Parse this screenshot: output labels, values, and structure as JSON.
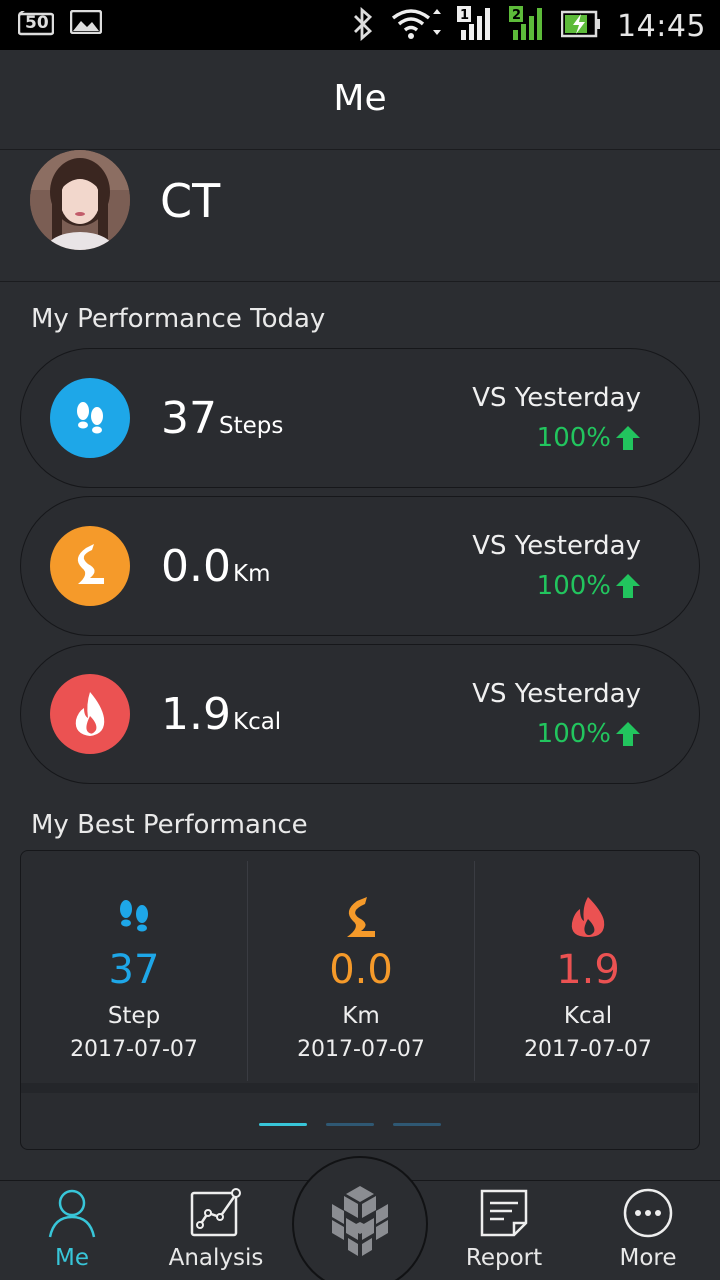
{
  "status_bar": {
    "time": "14:45",
    "notification_badge": "50",
    "icons": [
      "notification-50-icon",
      "image-icon",
      "bluetooth-icon",
      "wifi-icon",
      "signal-sim1-icon",
      "signal-sim2-icon",
      "battery-charging-icon"
    ]
  },
  "header": {
    "title": "Me"
  },
  "profile": {
    "name": "CT"
  },
  "today": {
    "section_title": "My Performance Today",
    "items": [
      {
        "value": "37",
        "unit": "Steps",
        "vs_label": "VS Yesterday",
        "change": "100%",
        "icon": "footprints-icon",
        "color": "#1ea7e8"
      },
      {
        "value": "0.0",
        "unit": "Km",
        "vs_label": "VS Yesterday",
        "change": "100%",
        "icon": "road-icon",
        "color": "#f59a2a"
      },
      {
        "value": "1.9",
        "unit": "Kcal",
        "vs_label": "VS Yesterday",
        "change": "100%",
        "icon": "flame-icon",
        "color": "#eb5252"
      }
    ]
  },
  "best": {
    "section_title": "My Best Performance",
    "items": [
      {
        "value": "37",
        "unit": "Step",
        "date": "2017-07-07",
        "icon": "footprints-icon",
        "color": "#1ea7e8"
      },
      {
        "value": "0.0",
        "unit": "Km",
        "date": "2017-07-07",
        "icon": "road-icon",
        "color": "#f59a2a"
      },
      {
        "value": "1.9",
        "unit": "Kcal",
        "date": "2017-07-07",
        "icon": "flame-icon",
        "color": "#eb5252"
      }
    ],
    "page_indicator": {
      "count": 3,
      "active": 1
    }
  },
  "bottom_nav": {
    "items": [
      {
        "label": "Me",
        "icon": "person-icon",
        "active": true
      },
      {
        "label": "Analysis",
        "icon": "chart-icon",
        "active": false
      },
      {
        "label": "Report",
        "icon": "report-icon",
        "active": false
      },
      {
        "label": "More",
        "icon": "more-icon",
        "active": false
      }
    ],
    "center_icon": "cubes-logo-icon"
  },
  "colors": {
    "accent": "#38c6d9",
    "up": "#22c55e",
    "background": "#2b2d31"
  }
}
